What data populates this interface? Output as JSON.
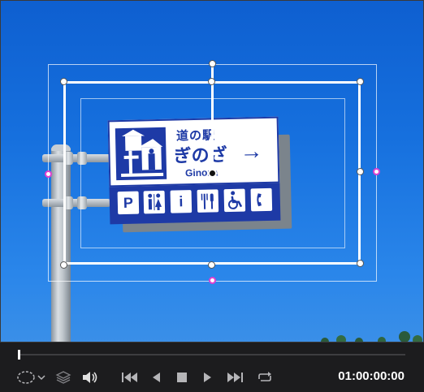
{
  "viewer": {
    "sign": {
      "line1": "道の駅",
      "line2": "ぎのざ",
      "line3": "Ginoza",
      "arrow": "→",
      "symbols": [
        "P",
        "restroom",
        "i",
        "restaurant",
        "accessible",
        "phone"
      ]
    }
  },
  "transport": {
    "timecode": "01:00:00:00",
    "icons": [
      "transform-mode-icon",
      "chevron-down-icon",
      "layers-icon",
      "volume-icon",
      "go-to-start-icon",
      "step-back-icon",
      "stop-icon",
      "play-icon",
      "go-to-end-icon",
      "loop-icon"
    ]
  }
}
